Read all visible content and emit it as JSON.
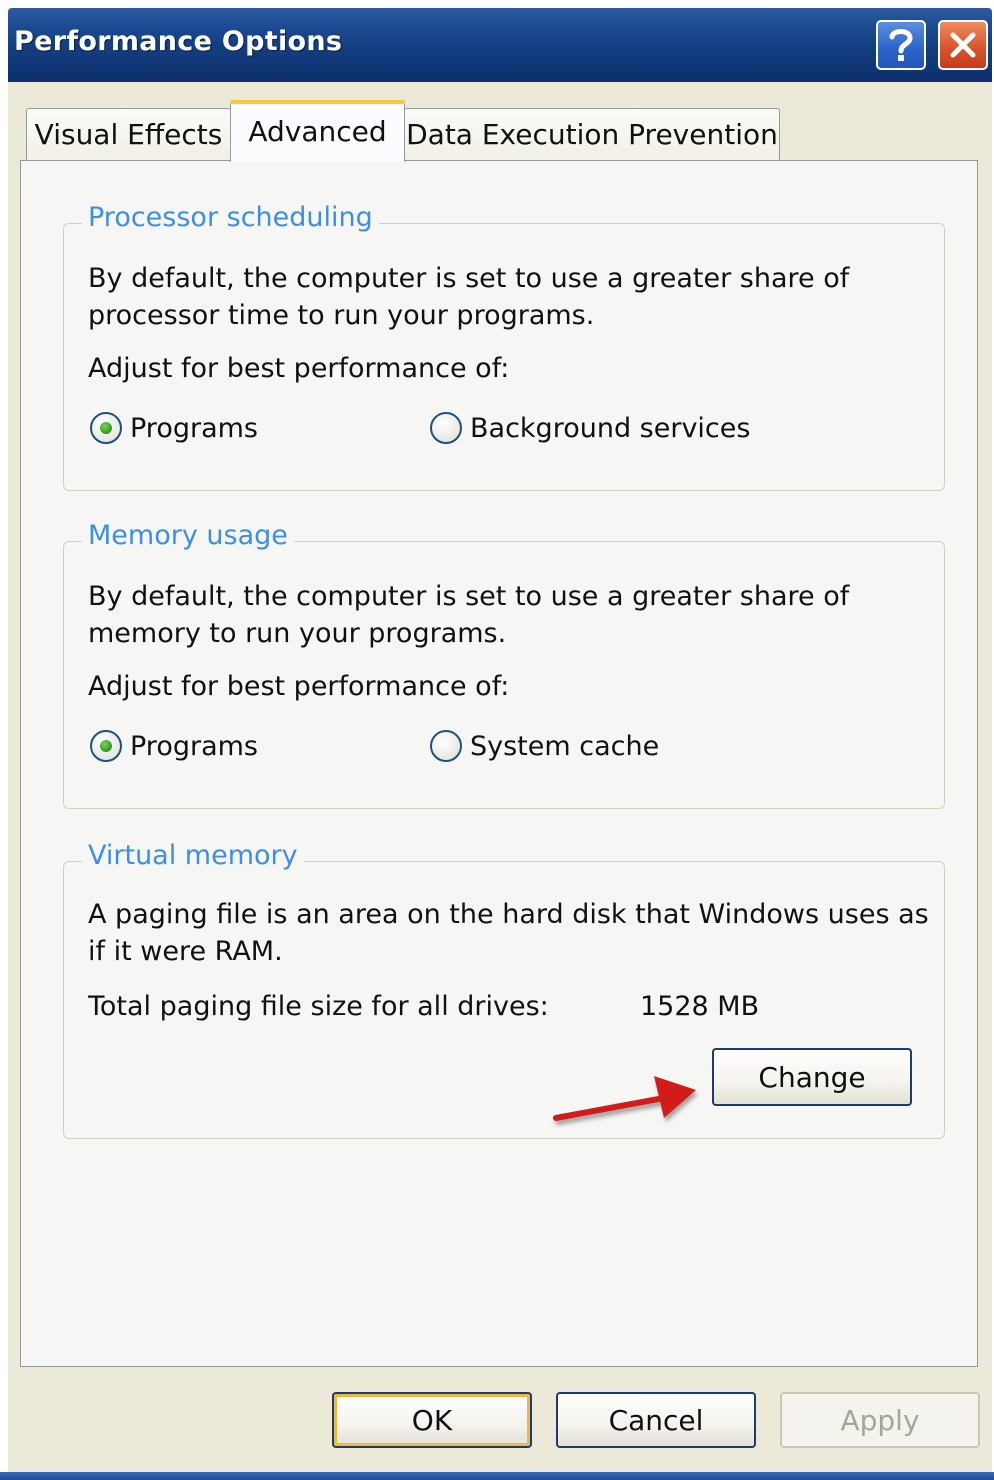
{
  "window": {
    "title": "Performance Options"
  },
  "titlebar": {
    "help_icon": "question-mark-icon",
    "close_icon": "close-x-icon"
  },
  "tabs": [
    {
      "label": "Visual Effects"
    },
    {
      "label": "Advanced",
      "active": true
    },
    {
      "label": "Data Execution Prevention"
    }
  ],
  "processor_scheduling": {
    "legend": "Processor scheduling",
    "description_line1": "By default, the computer is set to use a greater share of",
    "description_line2": "processor time to run your programs.",
    "adjust_label": "Adjust for best performance of:",
    "options": [
      {
        "label": "Programs",
        "selected": true
      },
      {
        "label": "Background services",
        "selected": false
      }
    ]
  },
  "memory_usage": {
    "legend": "Memory usage",
    "description_line1": "By default, the computer is set to use a greater share of",
    "description_line2": "memory to run your programs.",
    "adjust_label": "Adjust for best performance of:",
    "options": [
      {
        "label": "Programs",
        "selected": true
      },
      {
        "label": "System cache",
        "selected": false
      }
    ]
  },
  "virtual_memory": {
    "legend": "Virtual memory",
    "description_line1": "A paging file is an area on the hard disk that Windows uses as",
    "description_line2": "if it were RAM.",
    "total_label": "Total paging file size for all drives:",
    "total_value": "1528 MB",
    "change_button": "Change"
  },
  "buttons": {
    "ok": "OK",
    "cancel": "Cancel",
    "apply": "Apply"
  },
  "colors": {
    "titlebar": "#143f82",
    "legend_text": "#3d8fe6",
    "active_tab_highlight": "#ffc83c",
    "annotation_arrow": "#d21e1e"
  }
}
